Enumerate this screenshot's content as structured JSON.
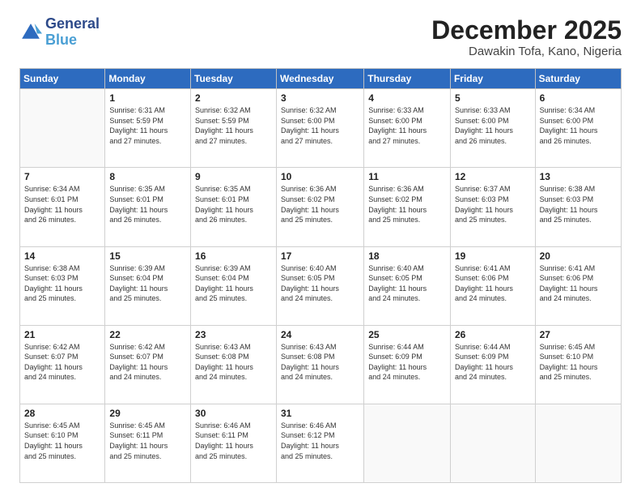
{
  "logo": {
    "line1": "General",
    "line2": "Blue"
  },
  "header": {
    "month": "December 2025",
    "location": "Dawakin Tofa, Kano, Nigeria"
  },
  "days_of_week": [
    "Sunday",
    "Monday",
    "Tuesday",
    "Wednesday",
    "Thursday",
    "Friday",
    "Saturday"
  ],
  "weeks": [
    [
      {
        "day": "",
        "info": ""
      },
      {
        "day": "1",
        "info": "Sunrise: 6:31 AM\nSunset: 5:59 PM\nDaylight: 11 hours\nand 27 minutes."
      },
      {
        "day": "2",
        "info": "Sunrise: 6:32 AM\nSunset: 5:59 PM\nDaylight: 11 hours\nand 27 minutes."
      },
      {
        "day": "3",
        "info": "Sunrise: 6:32 AM\nSunset: 6:00 PM\nDaylight: 11 hours\nand 27 minutes."
      },
      {
        "day": "4",
        "info": "Sunrise: 6:33 AM\nSunset: 6:00 PM\nDaylight: 11 hours\nand 27 minutes."
      },
      {
        "day": "5",
        "info": "Sunrise: 6:33 AM\nSunset: 6:00 PM\nDaylight: 11 hours\nand 26 minutes."
      },
      {
        "day": "6",
        "info": "Sunrise: 6:34 AM\nSunset: 6:00 PM\nDaylight: 11 hours\nand 26 minutes."
      }
    ],
    [
      {
        "day": "7",
        "info": "Sunrise: 6:34 AM\nSunset: 6:01 PM\nDaylight: 11 hours\nand 26 minutes."
      },
      {
        "day": "8",
        "info": "Sunrise: 6:35 AM\nSunset: 6:01 PM\nDaylight: 11 hours\nand 26 minutes."
      },
      {
        "day": "9",
        "info": "Sunrise: 6:35 AM\nSunset: 6:01 PM\nDaylight: 11 hours\nand 26 minutes."
      },
      {
        "day": "10",
        "info": "Sunrise: 6:36 AM\nSunset: 6:02 PM\nDaylight: 11 hours\nand 25 minutes."
      },
      {
        "day": "11",
        "info": "Sunrise: 6:36 AM\nSunset: 6:02 PM\nDaylight: 11 hours\nand 25 minutes."
      },
      {
        "day": "12",
        "info": "Sunrise: 6:37 AM\nSunset: 6:03 PM\nDaylight: 11 hours\nand 25 minutes."
      },
      {
        "day": "13",
        "info": "Sunrise: 6:38 AM\nSunset: 6:03 PM\nDaylight: 11 hours\nand 25 minutes."
      }
    ],
    [
      {
        "day": "14",
        "info": "Sunrise: 6:38 AM\nSunset: 6:03 PM\nDaylight: 11 hours\nand 25 minutes."
      },
      {
        "day": "15",
        "info": "Sunrise: 6:39 AM\nSunset: 6:04 PM\nDaylight: 11 hours\nand 25 minutes."
      },
      {
        "day": "16",
        "info": "Sunrise: 6:39 AM\nSunset: 6:04 PM\nDaylight: 11 hours\nand 25 minutes."
      },
      {
        "day": "17",
        "info": "Sunrise: 6:40 AM\nSunset: 6:05 PM\nDaylight: 11 hours\nand 24 minutes."
      },
      {
        "day": "18",
        "info": "Sunrise: 6:40 AM\nSunset: 6:05 PM\nDaylight: 11 hours\nand 24 minutes."
      },
      {
        "day": "19",
        "info": "Sunrise: 6:41 AM\nSunset: 6:06 PM\nDaylight: 11 hours\nand 24 minutes."
      },
      {
        "day": "20",
        "info": "Sunrise: 6:41 AM\nSunset: 6:06 PM\nDaylight: 11 hours\nand 24 minutes."
      }
    ],
    [
      {
        "day": "21",
        "info": "Sunrise: 6:42 AM\nSunset: 6:07 PM\nDaylight: 11 hours\nand 24 minutes."
      },
      {
        "day": "22",
        "info": "Sunrise: 6:42 AM\nSunset: 6:07 PM\nDaylight: 11 hours\nand 24 minutes."
      },
      {
        "day": "23",
        "info": "Sunrise: 6:43 AM\nSunset: 6:08 PM\nDaylight: 11 hours\nand 24 minutes."
      },
      {
        "day": "24",
        "info": "Sunrise: 6:43 AM\nSunset: 6:08 PM\nDaylight: 11 hours\nand 24 minutes."
      },
      {
        "day": "25",
        "info": "Sunrise: 6:44 AM\nSunset: 6:09 PM\nDaylight: 11 hours\nand 24 minutes."
      },
      {
        "day": "26",
        "info": "Sunrise: 6:44 AM\nSunset: 6:09 PM\nDaylight: 11 hours\nand 24 minutes."
      },
      {
        "day": "27",
        "info": "Sunrise: 6:45 AM\nSunset: 6:10 PM\nDaylight: 11 hours\nand 25 minutes."
      }
    ],
    [
      {
        "day": "28",
        "info": "Sunrise: 6:45 AM\nSunset: 6:10 PM\nDaylight: 11 hours\nand 25 minutes."
      },
      {
        "day": "29",
        "info": "Sunrise: 6:45 AM\nSunset: 6:11 PM\nDaylight: 11 hours\nand 25 minutes."
      },
      {
        "day": "30",
        "info": "Sunrise: 6:46 AM\nSunset: 6:11 PM\nDaylight: 11 hours\nand 25 minutes."
      },
      {
        "day": "31",
        "info": "Sunrise: 6:46 AM\nSunset: 6:12 PM\nDaylight: 11 hours\nand 25 minutes."
      },
      {
        "day": "",
        "info": ""
      },
      {
        "day": "",
        "info": ""
      },
      {
        "day": "",
        "info": ""
      }
    ]
  ]
}
